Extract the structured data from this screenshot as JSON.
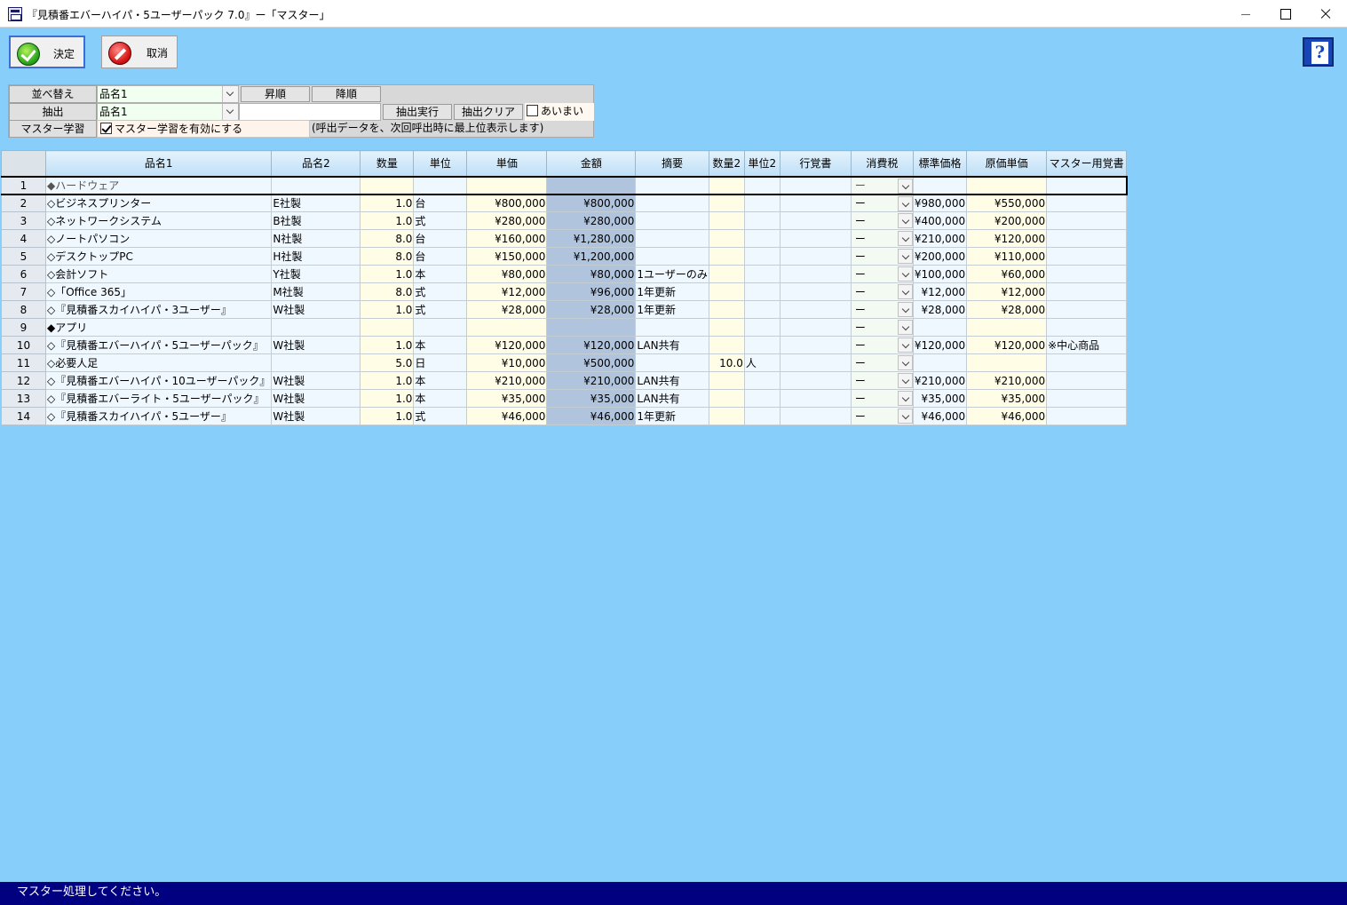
{
  "window": {
    "title": "『見積番エバーハイパ・5ユーザーパック 7.0』ー「マスター」"
  },
  "toolbar": {
    "ok_label": "決定",
    "cancel_label": "取消",
    "help_label": "?"
  },
  "panel": {
    "sort_label": "並べ替え",
    "sort_field": "品名1",
    "asc_label": "昇順",
    "desc_label": "降順",
    "filter_label": "抽出",
    "filter_field": "品名1",
    "filter_value": "",
    "exec_label": "抽出実行",
    "clear_label": "抽出クリア",
    "fuzzy_label": "あいまい",
    "learn_label": "マスター学習",
    "learn_checkbox": "マスター学習を有効にする",
    "learn_note": "(呼出データを、次回呼出時に最上位表示します)"
  },
  "grid": {
    "headers": [
      "品名1",
      "品名2",
      "数量",
      "単位",
      "単価",
      "金額",
      "摘要",
      "数量2",
      "単位2",
      "行覚書",
      "消費税",
      "標準価格",
      "原価単価",
      "マスター用覚書"
    ],
    "rows": [
      [
        "1",
        "◆ハードウェア",
        "",
        "",
        "",
        "",
        "",
        "",
        "",
        "",
        "",
        "ー",
        "",
        "",
        ""
      ],
      [
        "2",
        "◇ビジネスプリンター",
        "E社製",
        "1.0",
        "台",
        "¥800,000",
        "¥800,000",
        "",
        "",
        "",
        "",
        "ー",
        "¥980,000",
        "¥550,000",
        ""
      ],
      [
        "3",
        "◇ネットワークシステム",
        "B社製",
        "1.0",
        "式",
        "¥280,000",
        "¥280,000",
        "",
        "",
        "",
        "",
        "ー",
        "¥400,000",
        "¥200,000",
        ""
      ],
      [
        "4",
        "◇ノートパソコン",
        "N社製",
        "8.0",
        "台",
        "¥160,000",
        "¥1,280,000",
        "",
        "",
        "",
        "",
        "ー",
        "¥210,000",
        "¥120,000",
        ""
      ],
      [
        "5",
        "◇デスクトップPC",
        "H社製",
        "8.0",
        "台",
        "¥150,000",
        "¥1,200,000",
        "",
        "",
        "",
        "",
        "ー",
        "¥200,000",
        "¥110,000",
        ""
      ],
      [
        "6",
        "◇会計ソフト",
        "Y社製",
        "1.0",
        "本",
        "¥80,000",
        "¥80,000",
        "1ユーザーのみ",
        "",
        "",
        "",
        "ー",
        "¥100,000",
        "¥60,000",
        ""
      ],
      [
        "7",
        "◇「Office 365」",
        "M社製",
        "8.0",
        "式",
        "¥12,000",
        "¥96,000",
        "1年更新",
        "",
        "",
        "",
        "ー",
        "¥12,000",
        "¥12,000",
        ""
      ],
      [
        "8",
        "◇『見積番スカイハイパ・3ユーザー』",
        "W社製",
        "1.0",
        "式",
        "¥28,000",
        "¥28,000",
        "1年更新",
        "",
        "",
        "",
        "ー",
        "¥28,000",
        "¥28,000",
        ""
      ],
      [
        "9",
        "◆アプリ",
        "",
        "",
        "",
        "",
        "",
        "",
        "",
        "",
        "",
        "ー",
        "",
        "",
        ""
      ],
      [
        "10",
        "◇『見積番エバーハイパ・5ユーザーパック』",
        "W社製",
        "1.0",
        "本",
        "¥120,000",
        "¥120,000",
        "LAN共有",
        "",
        "",
        "",
        "ー",
        "¥120,000",
        "¥120,000",
        "※中心商品"
      ],
      [
        "11",
        "◇必要人足",
        "",
        "5.0",
        "日",
        "¥10,000",
        "¥500,000",
        "",
        "10.0",
        "人",
        "",
        "ー",
        "",
        "",
        ""
      ],
      [
        "12",
        "◇『見積番エバーハイパ・10ユーザーパック』",
        "W社製",
        "1.0",
        "本",
        "¥210,000",
        "¥210,000",
        "LAN共有",
        "",
        "",
        "",
        "ー",
        "¥210,000",
        "¥210,000",
        ""
      ],
      [
        "13",
        "◇『見積番エバーライト・5ユーザーパック』",
        "W社製",
        "1.0",
        "本",
        "¥35,000",
        "¥35,000",
        "LAN共有",
        "",
        "",
        "",
        "ー",
        "¥35,000",
        "¥35,000",
        ""
      ],
      [
        "14",
        "◇『見積番スカイハイパ・5ユーザー』",
        "W社製",
        "1.0",
        "式",
        "¥46,000",
        "¥46,000",
        "1年更新",
        "",
        "",
        "",
        "ー",
        "¥46,000",
        "¥46,000",
        ""
      ]
    ]
  },
  "status": {
    "message": "マスター処理してください。"
  }
}
